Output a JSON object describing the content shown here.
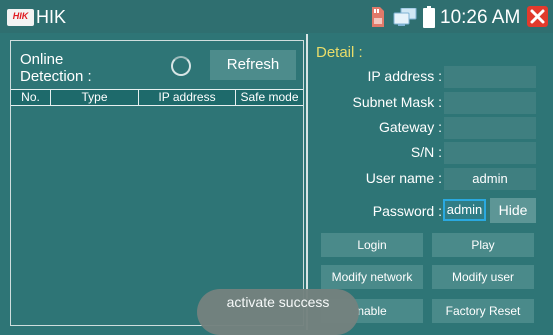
{
  "titlebar": {
    "logo": "HIK",
    "title": "HIK",
    "time": "10:26 AM",
    "icons": [
      "sd-card-icon",
      "network-icon",
      "battery-icon",
      "close-icon"
    ]
  },
  "left": {
    "online_label_line1": "Online",
    "online_label_line2": "Detection :",
    "refresh_label": "Refresh",
    "columns": [
      "No.",
      "Type",
      "IP address",
      "Safe mode"
    ]
  },
  "detail": {
    "title": "Detail :",
    "ip_label": "IP address :",
    "ip_value": "",
    "mask_label": "Subnet Mask :",
    "mask_value": "",
    "gateway_label": "Gateway :",
    "gateway_value": "",
    "sn_label": "S/N :",
    "sn_value": "",
    "user_label": "User name :",
    "user_value": "admin",
    "password_label": "Password :",
    "password_value": "admin",
    "hide_label": "Hide"
  },
  "actions": {
    "login": "Login",
    "play": "Play",
    "modify_network": "Modify network",
    "modify_user": "Modify user",
    "enable": "nable",
    "factory_reset": "Factory Reset"
  },
  "toast": "activate success",
  "colors": {
    "background": "#2e7576",
    "header": "#1e6a6b",
    "button": "#4a8a8a",
    "detail_title": "#e9dc6a",
    "close": "#e23a2c"
  }
}
